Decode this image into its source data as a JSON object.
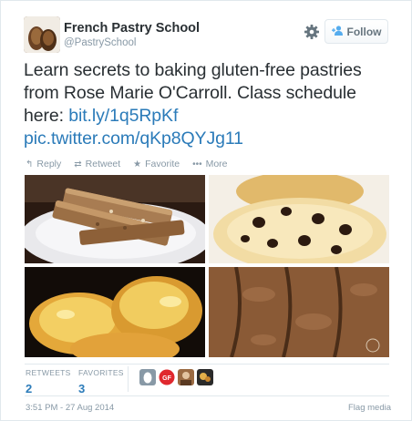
{
  "user": {
    "name": "French Pastry School",
    "handle": "@PastrySchool"
  },
  "follow_button": {
    "label": "Follow"
  },
  "tweet": {
    "text_plain": "Learn secrets to baking gluten-free pastries from Rose Marie O'Carroll. Class schedule here: ",
    "link1": "bit.ly/1q5RpKf",
    "link2": "pic.twitter.com/qKp8QYJg11"
  },
  "actions": {
    "reply": "Reply",
    "retweet": "Retweet",
    "favorite": "Favorite",
    "more": "More"
  },
  "stats": {
    "retweets_label": "RETWEETS",
    "retweets_count": "2",
    "favorites_label": "FAVORITES",
    "favorites_count": "3"
  },
  "favoriters": [
    {
      "icon": "egg-avatar",
      "color": "#8899a6"
    },
    {
      "icon": "gf-avatar",
      "color": "#e0282e",
      "text": "GF"
    },
    {
      "icon": "photo-avatar",
      "color": "#9b6b43"
    },
    {
      "icon": "photo-avatar",
      "color": "#2a2a2a"
    }
  ],
  "footer": {
    "timestamp": "3:51 PM - 27 Aug 2014",
    "flag": "Flag media"
  },
  "colors": {
    "link": "#2b7bb9",
    "muted": "#8899a6",
    "text": "#292f33",
    "border": "#e1e8ed"
  }
}
